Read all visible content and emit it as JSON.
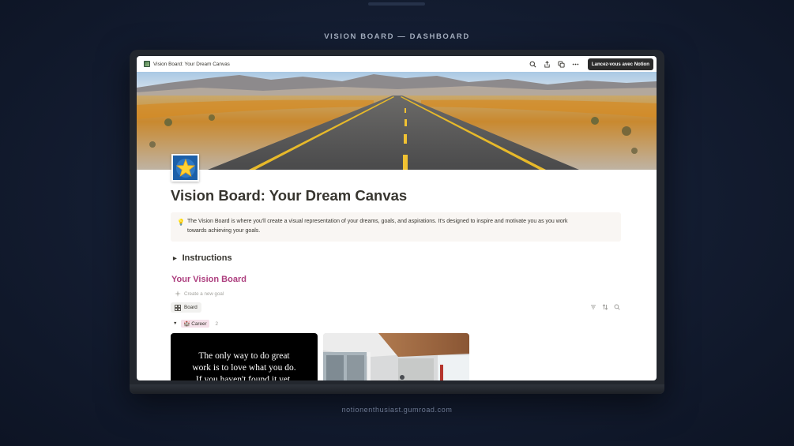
{
  "heading": "VISION BOARD — DASHBOARD",
  "footer": "notionenthusiast.gumroad.com",
  "browser": {
    "tab_title": "Vision Board: Your Dream Canvas",
    "cta_label": "Lancez-vous avec Notion",
    "icons": [
      "search-icon",
      "share-icon",
      "duplicate-icon",
      "more-icon"
    ]
  },
  "page": {
    "icon": "star-icon",
    "title": "Vision Board: Your Dream Canvas",
    "callout_icon": "lightbulb-icon",
    "callout_text_line1": "The Vision Board is where you'll create a visual representation of your dreams, goals, and aspirations. It's designed to inspire and motivate you as you work",
    "callout_text_line2": "towards achieving your goals.",
    "toggle_label": "Instructions",
    "section_title": "Your Vision Board",
    "new_goal_label": "Create a new goal",
    "view_tab_label": "Board",
    "group": {
      "label": "Career",
      "emoji": "🏰",
      "count": "2"
    },
    "cards": [
      {
        "type": "quote",
        "lines": [
          "The only way to do great",
          "work is to love what you do.",
          "If you haven't found it yet,"
        ]
      },
      {
        "type": "image",
        "alt": "office-interior"
      }
    ]
  },
  "colors": {
    "section_title": "#ad3e7e",
    "callout_bg": "#f9f6f3",
    "career_tag_bg": "#f5e0e9",
    "cta_bg": "#2b2b2b"
  }
}
